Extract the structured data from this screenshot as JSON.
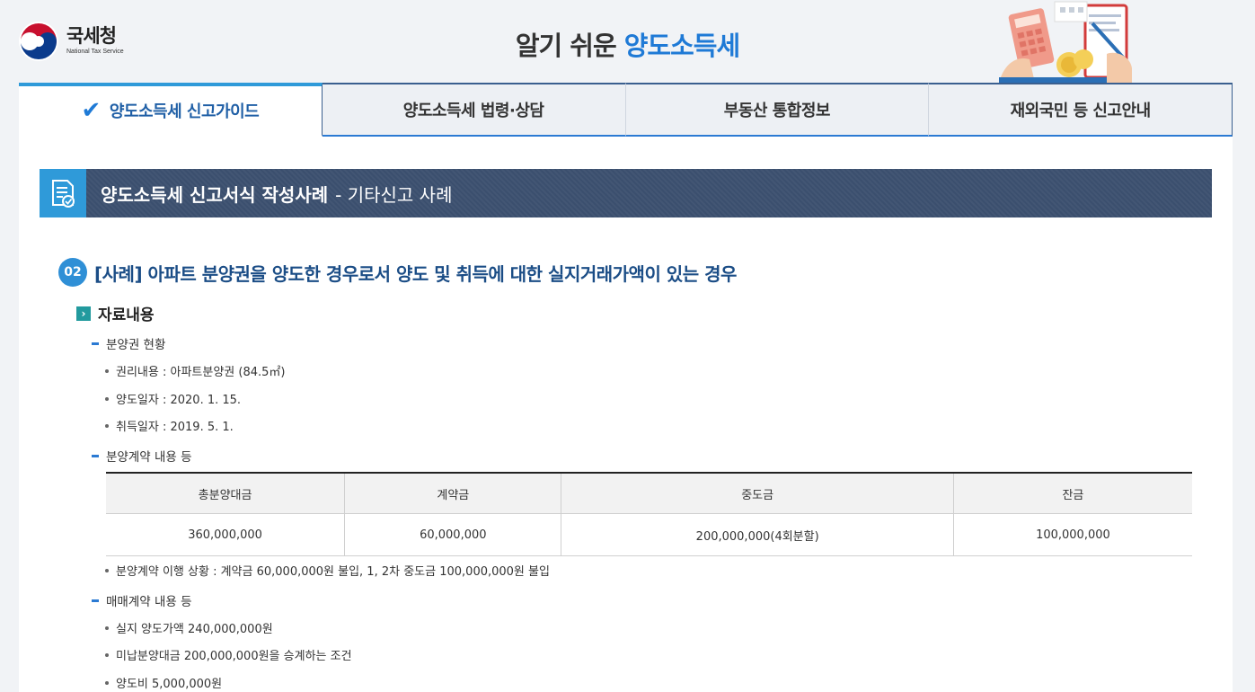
{
  "header": {
    "logo_ko": "국세청",
    "logo_en": "National Tax Service",
    "title_plain": "알기 쉬운 ",
    "title_highlight": "양도소득세",
    "accent_color": "#1f7ad6"
  },
  "tabs": [
    {
      "label": "양도소득세 신고가이드",
      "active": true
    },
    {
      "label": "양도소득세 법령·상담",
      "active": false
    },
    {
      "label": "부동산 통합정보",
      "active": false
    },
    {
      "label": "재외국민 등 신고안내",
      "active": false
    }
  ],
  "section": {
    "title": "양도소득세 신고서식 작성사례",
    "subtitle": "- 기타신고 사례",
    "icon": "document-check-icon"
  },
  "case": {
    "number": "02",
    "title": "[사례] 아파트 분양권을 양도한 경우로서 양도 및 취득에 대한 실지거래가액이 있는 경우"
  },
  "material": {
    "heading": "자료내용",
    "group1": {
      "label": "분양권 현황",
      "items": [
        "권리내용 : 아파트분양권 (84.5㎡)",
        "양도일자 : 2020. 1. 15.",
        "취득일자 : 2019. 5. 1."
      ]
    },
    "group2": {
      "label": "분양계약 내용 등",
      "table": {
        "headers": [
          "총분양대금",
          "계약금",
          "중도금",
          "잔금"
        ],
        "row": [
          "360,000,000",
          "60,000,000",
          "200,000,000(4회분할)",
          "100,000,000"
        ]
      },
      "note": "분양계약 이행 상황 : 계약금 60,000,000원 불입, 1, 2차 중도금 100,000,000원 불입"
    },
    "group3": {
      "label": "매매계약 내용 등",
      "items": [
        "실지 양도가액 240,000,000원",
        "미납분양대금 200,000,000원을 승계하는 조건",
        "양도비 5,000,000원"
      ]
    }
  }
}
